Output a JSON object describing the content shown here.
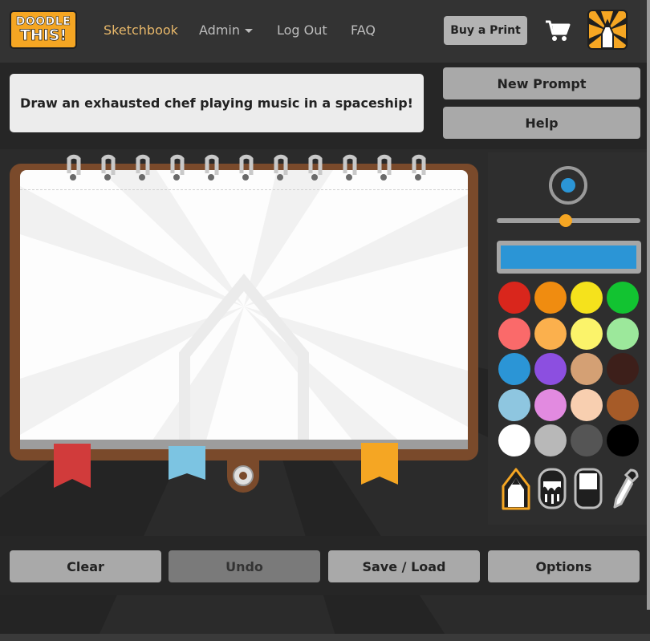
{
  "nav": {
    "logo_line1": "DOODLE",
    "logo_line2": "THIS!",
    "links": [
      "Sketchbook",
      "Admin",
      "Log Out",
      "FAQ"
    ],
    "active_link": "Sketchbook",
    "buy_label": "Buy a Print",
    "cart_icon": "cart-icon",
    "avatar_icon": "pencil-logo-icon"
  },
  "prompt": {
    "text": "Draw an exhausted chef playing music in a spaceship!",
    "new_prompt_label": "New Prompt",
    "help_label": "Help"
  },
  "tools": {
    "brush_size_level": 0.48,
    "current_color": "#2b95d6",
    "palette": [
      "#d9261c",
      "#f08c10",
      "#f5e21c",
      "#12c331",
      "#fa6a6a",
      "#fbb04d",
      "#fbf36a",
      "#9ce89b",
      "#2b95d6",
      "#8c4fe0",
      "#d4a074",
      "#3d1f1a",
      "#8ec6e0",
      "#e28ae0",
      "#f8cfb0",
      "#a65b28",
      "#ffffff",
      "#b8b8b8",
      "#555555",
      "#000000"
    ],
    "tool_icons": [
      "pencil-icon",
      "paint-bucket-icon",
      "eraser-icon",
      "eyedropper-icon"
    ],
    "selected_tool": "pencil-icon"
  },
  "actions": {
    "clear_label": "Clear",
    "undo_label": "Undo",
    "save_label": "Save / Load",
    "options_label": "Options"
  },
  "colors": {
    "accent": "#f5a623",
    "notebook": "#7a4a2b",
    "ribbons": [
      "#d13b3b",
      "#7cc4e2",
      "#f5a623"
    ]
  }
}
